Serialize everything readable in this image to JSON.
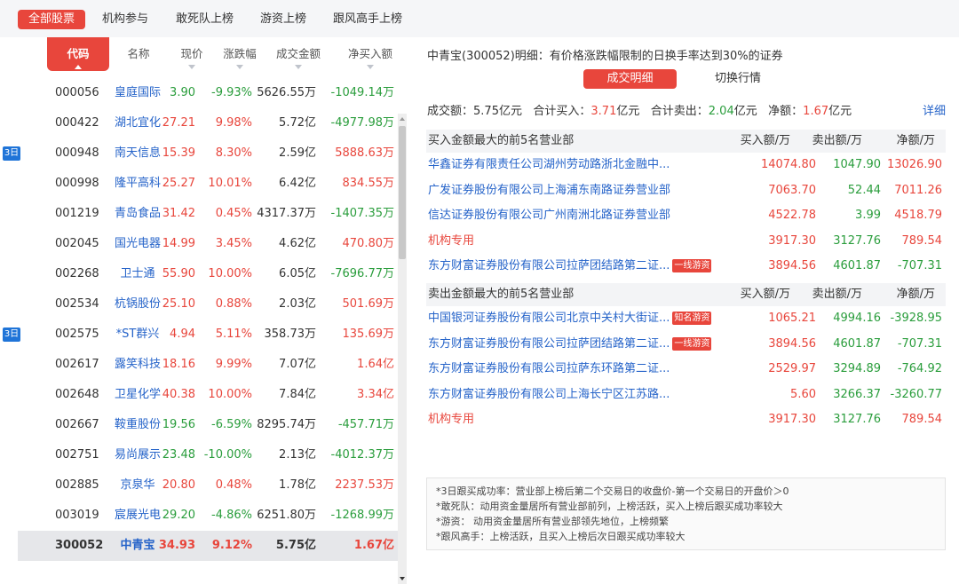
{
  "tabs": [
    {
      "label": "全部股票",
      "active": true
    },
    {
      "label": "机构参与"
    },
    {
      "label": "敢死队上榜"
    },
    {
      "label": "游资上榜"
    },
    {
      "label": "跟风高手上榜"
    }
  ],
  "table": {
    "headers": {
      "code": "代码",
      "name": "名称",
      "price": "现价",
      "change": "涨跌幅",
      "amount": "成交金额",
      "net": "净买入额"
    },
    "rows": [
      {
        "badge": "",
        "code": "000056",
        "name": "皇庭国际",
        "price": "3.90",
        "change": "-9.93%",
        "amount": "5626.55万",
        "net": "-1049.14万"
      },
      {
        "badge": "",
        "code": "000422",
        "name": "湖北宜化",
        "price": "27.21",
        "change": "9.98%",
        "amount": "5.72亿",
        "net": "-4977.98万"
      },
      {
        "badge": "3日",
        "code": "000948",
        "name": "南天信息",
        "price": "15.39",
        "change": "8.30%",
        "amount": "2.59亿",
        "net": "5888.63万"
      },
      {
        "badge": "",
        "code": "000998",
        "name": "隆平高科",
        "price": "25.27",
        "change": "10.01%",
        "amount": "6.42亿",
        "net": "834.55万"
      },
      {
        "badge": "",
        "code": "001219",
        "name": "青岛食品",
        "price": "31.42",
        "change": "0.45%",
        "amount": "4317.37万",
        "net": "-1407.35万"
      },
      {
        "badge": "",
        "code": "002045",
        "name": "国光电器",
        "price": "14.99",
        "change": "3.45%",
        "amount": "4.62亿",
        "net": "470.80万"
      },
      {
        "badge": "",
        "code": "002268",
        "name": "卫士通",
        "price": "55.90",
        "change": "10.00%",
        "amount": "6.05亿",
        "net": "-7696.77万"
      },
      {
        "badge": "",
        "code": "002534",
        "name": "杭锅股份",
        "price": "25.10",
        "change": "0.88%",
        "amount": "2.03亿",
        "net": "501.69万"
      },
      {
        "badge": "3日",
        "code": "002575",
        "name": "*ST群兴",
        "price": "4.94",
        "change": "5.11%",
        "amount": "358.73万",
        "net": "135.69万"
      },
      {
        "badge": "",
        "code": "002617",
        "name": "露笑科技",
        "price": "18.16",
        "change": "9.99%",
        "amount": "7.07亿",
        "net": "1.64亿"
      },
      {
        "badge": "",
        "code": "002648",
        "name": "卫星化学",
        "price": "40.38",
        "change": "10.00%",
        "amount": "7.84亿",
        "net": "3.34亿"
      },
      {
        "badge": "",
        "code": "002667",
        "name": "鞍重股份",
        "price": "19.56",
        "change": "-6.59%",
        "amount": "8295.74万",
        "net": "-457.71万"
      },
      {
        "badge": "",
        "code": "002751",
        "name": "易尚展示",
        "price": "23.48",
        "change": "-10.00%",
        "amount": "2.13亿",
        "net": "-4012.37万"
      },
      {
        "badge": "",
        "code": "002885",
        "name": "京泉华",
        "price": "20.80",
        "change": "0.48%",
        "amount": "1.78亿",
        "net": "2237.53万"
      },
      {
        "badge": "",
        "code": "003019",
        "name": "宸展光电",
        "price": "29.20",
        "change": "-4.86%",
        "amount": "6251.80万",
        "net": "-1268.99万"
      },
      {
        "badge": "",
        "code": "300052",
        "name": "中青宝",
        "price": "34.93",
        "change": "9.12%",
        "amount": "5.75亿",
        "net": "1.67亿",
        "selected": true
      }
    ]
  },
  "detail": {
    "title": "中青宝(300052)明细：有价格涨跌幅限制的日换手率达到30%的证券",
    "btn_detail": "成交明细",
    "btn_switch": "切换行情",
    "summary": {
      "turnover_label": "成交额：",
      "turnover": "5.75亿元",
      "buy_label": "合计买入：",
      "buy": "3.71",
      "sell_label": "合计卖出：",
      "sell": "2.04",
      "net_label": "净额：",
      "net": "1.67",
      "unit": "亿元"
    },
    "more_link": "详细",
    "buy_section": {
      "title": "买入金额最大的前5名营业部",
      "col_buy": "买入额/万",
      "col_sell": "卖出额/万",
      "col_net": "净额/万",
      "rows": [
        {
          "name": "华鑫证券有限责任公司湖州劳动路浙北金融中...",
          "tag": "",
          "buy": "14074.80",
          "sell": "1047.90",
          "net": "13026.90",
          "neg": false,
          "inst": false
        },
        {
          "name": "广发证券股份有限公司上海浦东南路证券营业部",
          "tag": "",
          "buy": "7063.70",
          "sell": "52.44",
          "net": "7011.26",
          "neg": false,
          "inst": false
        },
        {
          "name": "信达证券股份有限公司广州南洲北路证券营业部",
          "tag": "",
          "buy": "4522.78",
          "sell": "3.99",
          "net": "4518.79",
          "neg": false,
          "inst": false
        },
        {
          "name": "机构专用",
          "tag": "",
          "buy": "3917.30",
          "sell": "3127.76",
          "net": "789.54",
          "neg": false,
          "inst": true
        },
        {
          "name": "东方财富证券股份有限公司拉萨团结路第二证...",
          "tag": "一线游资",
          "buy": "3894.56",
          "sell": "4601.87",
          "net": "-707.31",
          "neg": true,
          "inst": false
        }
      ]
    },
    "sell_section": {
      "title": "卖出金额最大的前5名营业部",
      "col_buy": "买入额/万",
      "col_sell": "卖出额/万",
      "col_net": "净额/万",
      "rows": [
        {
          "name": "中国银河证券股份有限公司北京中关村大街证...",
          "tag": "知名游资",
          "buy": "1065.21",
          "sell": "4994.16",
          "net": "-3928.95",
          "neg": true,
          "inst": false
        },
        {
          "name": "东方财富证券股份有限公司拉萨团结路第二证...",
          "tag": "一线游资",
          "buy": "3894.56",
          "sell": "4601.87",
          "net": "-707.31",
          "neg": true,
          "inst": false
        },
        {
          "name": "东方财富证券股份有限公司拉萨东环路第二证...",
          "tag": "",
          "buy": "2529.97",
          "sell": "3294.89",
          "net": "-764.92",
          "neg": true,
          "inst": false
        },
        {
          "name": "东方财富证券股份有限公司上海长宁区江苏路...",
          "tag": "",
          "buy": "5.60",
          "sell": "3266.37",
          "net": "-3260.77",
          "neg": true,
          "inst": false
        },
        {
          "name": "机构专用",
          "tag": "",
          "buy": "3917.30",
          "sell": "3127.76",
          "net": "789.54",
          "neg": false,
          "inst": true
        }
      ]
    },
    "notes": [
      "*3日跟买成功率：营业部上榜后第二个交易日的收盘价-第一个交易日的开盘价＞0",
      "*敢死队：动用资金量居所有营业部前列，上榜活跃，买入上榜后跟买成功率较大",
      "*游资：  动用资金量居所有营业部领先地位，上榜频繁",
      "*跟风高手：上榜活跃，且买入上榜后次日跟买成功率较大"
    ]
  },
  "colors": {
    "accent": "#e8463c",
    "up": "#e8463c",
    "down": "#2a9d3c",
    "link": "#2563c9",
    "badge": "#1f74d8"
  }
}
